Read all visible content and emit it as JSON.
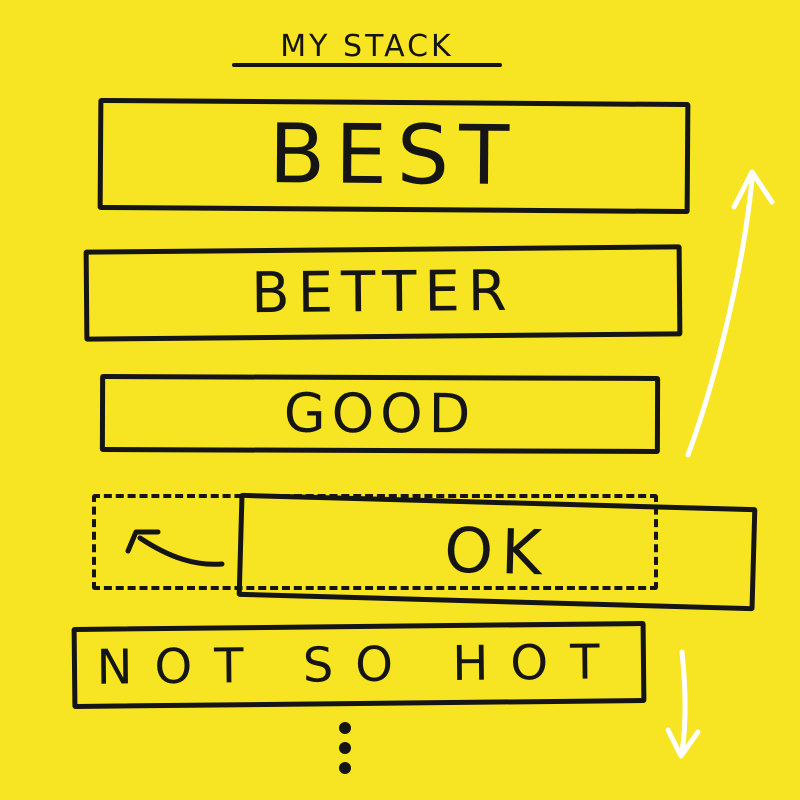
{
  "page": {
    "title": "MY STACK"
  },
  "stack": {
    "items": [
      {
        "label": "BEST"
      },
      {
        "label": "BETTER"
      },
      {
        "label": "GOOD"
      },
      {
        "label": "OK"
      },
      {
        "label": "NOT SO HOT"
      }
    ],
    "dragged_item_index": 3
  },
  "icons": {
    "up_arrow": "arrow-up-icon",
    "down_arrow": "arrow-down-icon",
    "drag_return": "arrow-left-return-icon",
    "more": "more-vertical-icon"
  },
  "colors": {
    "background": "#f7e422",
    "ink": "#151515",
    "arrows": "#ffffff"
  }
}
